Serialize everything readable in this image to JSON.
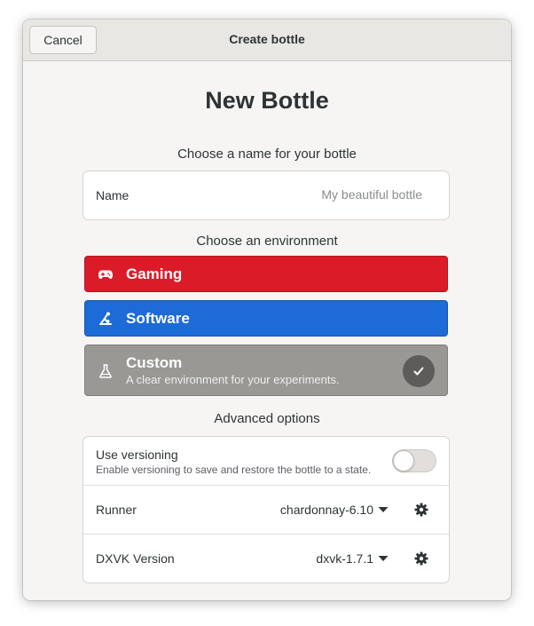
{
  "header": {
    "cancel_label": "Cancel",
    "title": "Create bottle"
  },
  "main": {
    "title": "New Bottle",
    "name_section_label": "Choose a name for your bottle",
    "name_field": {
      "label": "Name",
      "value": "",
      "placeholder": "My beautiful bottle"
    },
    "environment_section_label": "Choose an environment",
    "environments": [
      {
        "title": "Gaming",
        "icon": "gamepad-icon",
        "color": "#dc1b28"
      },
      {
        "title": "Software",
        "icon": "software-icon",
        "color": "#1c6bd6"
      },
      {
        "title": "Custom",
        "subtitle": "A clear environment for your experiments.",
        "icon": "flask-icon",
        "color": "#999894",
        "selected": true
      }
    ],
    "advanced_section_label": "Advanced options",
    "advanced": {
      "versioning": {
        "label": "Use versioning",
        "description": "Enable versioning to save and restore the bottle to a state.",
        "enabled": false
      },
      "runner": {
        "label": "Runner",
        "value": "chardonnay-6.10"
      },
      "dxvk": {
        "label": "DXVK Version",
        "value": "dxvk-1.7.1"
      }
    }
  }
}
